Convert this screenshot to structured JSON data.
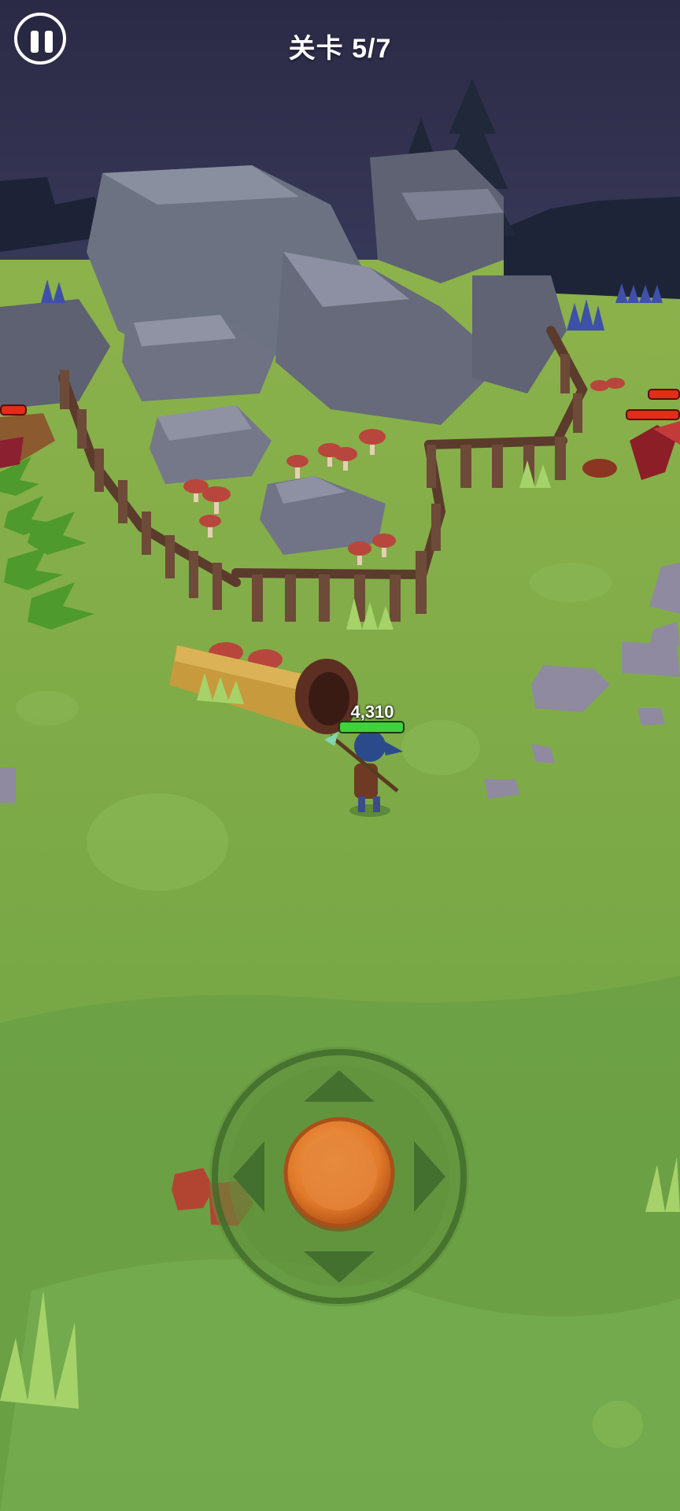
{
  "hud": {
    "pause_icon": "pause-icon",
    "level_label": "关卡 5/7"
  },
  "player": {
    "hp_value": "4,310",
    "hp_fraction": 1.0
  },
  "enemies": [
    {
      "hp_fraction": 1.0
    },
    {
      "hp_fraction": 1.0
    },
    {
      "hp_fraction": 1.0
    }
  ],
  "joystick": {
    "icon": "dpad-arrows-icon",
    "knob_color": "#e2782a"
  },
  "colors": {
    "night_sky": "#2a2a48",
    "grass": "#7aa845",
    "rock": "#6b6f80",
    "fence_wood": "#6e4a38",
    "hp_green": "#3fd23a",
    "hp_red": "#e52c18"
  }
}
